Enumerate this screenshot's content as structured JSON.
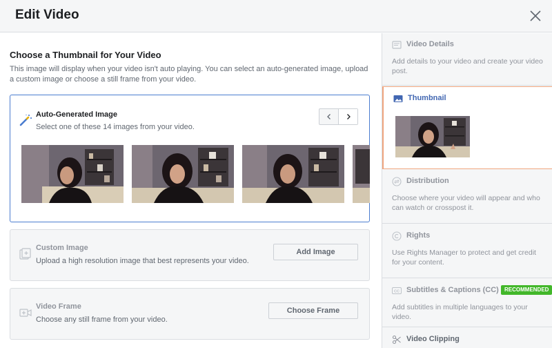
{
  "header": {
    "title": "Edit Video"
  },
  "main": {
    "heading": "Choose a Thumbnail for Your Video",
    "description": "This image will display when your video isn't auto playing. You can select an auto-generated image, upload a custom image or choose a still frame from your video.",
    "auto_generated": {
      "title": "Auto-Generated Image",
      "subtitle": "Select one of these 14 images from your video."
    },
    "custom_image": {
      "title": "Custom Image",
      "subtitle": "Upload a high resolution image that best represents your video.",
      "button": "Add Image"
    },
    "video_frame": {
      "title": "Video Frame",
      "subtitle": "Choose any still frame from your video.",
      "button": "Choose Frame"
    }
  },
  "sidebar": {
    "video_details": {
      "title": "Video Details",
      "desc": "Add details to your video and create your video post."
    },
    "thumbnail": {
      "title": "Thumbnail"
    },
    "distribution": {
      "title": "Distribution",
      "desc": "Choose where your video will appear and who can watch or crosspost it."
    },
    "rights": {
      "title": "Rights",
      "desc": "Use Rights Manager to protect and get credit for your content."
    },
    "subtitles": {
      "title": "Subtitles & Captions (CC)",
      "badge": "RECOMMENDED",
      "desc": "Add subtitles in multiple languages to your video."
    },
    "clipping": {
      "title": "Video Clipping"
    }
  },
  "colors": {
    "accent_blue": "#4267b2",
    "card_border_selected": "#4a7ccf",
    "active_sidebar_border": "#f0a57e",
    "badge_green": "#42b72a"
  },
  "icons": {
    "close": "close-icon",
    "wand": "magic-wand-icon",
    "prev": "chevron-left-icon",
    "next": "chevron-right-icon",
    "custom_image": "add-image-icon",
    "video_frame": "video-frame-icon",
    "video_details": "video-details-icon",
    "thumbnail": "image-icon",
    "distribution": "share-arrows-icon",
    "rights": "copyright-icon",
    "subtitles": "cc-icon",
    "clipping": "scissors-icon"
  }
}
